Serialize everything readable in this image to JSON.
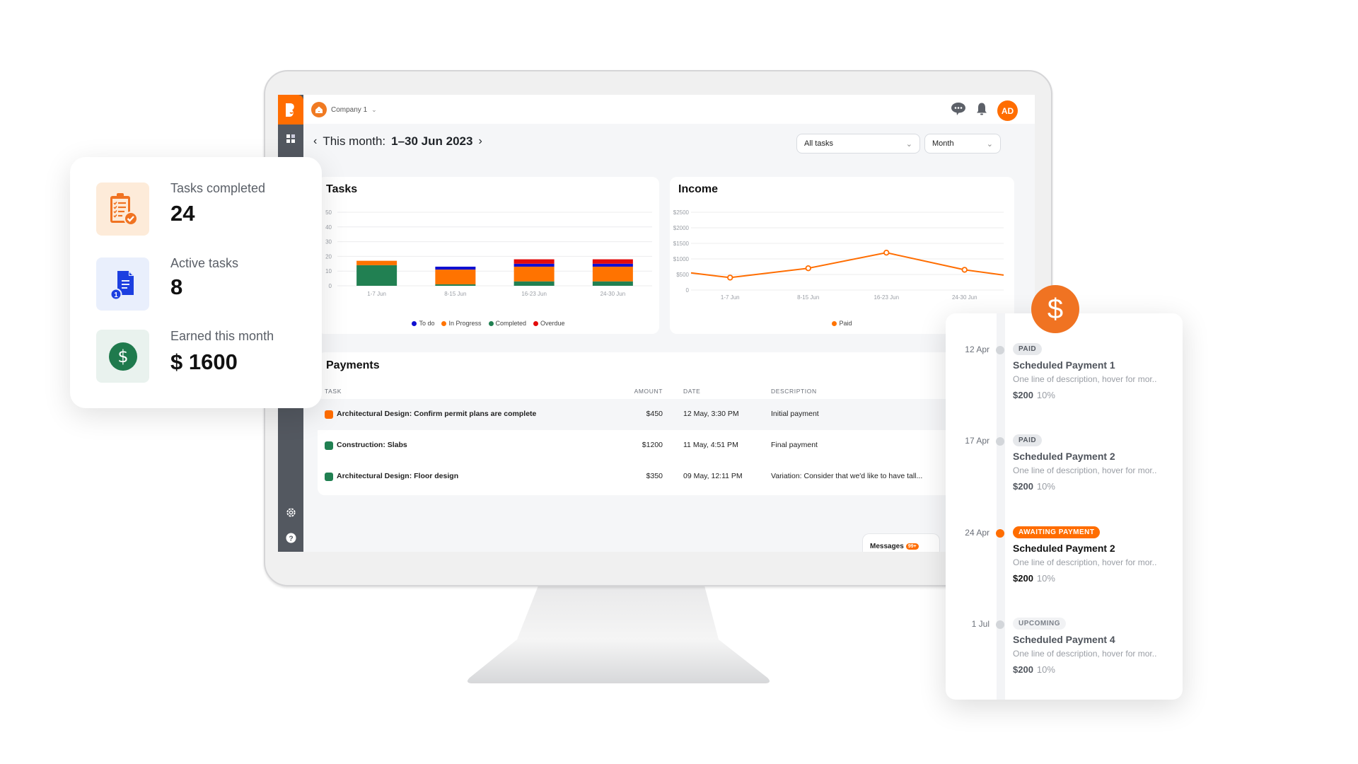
{
  "app": {
    "company": "Company 1",
    "period_prefix": "This month:",
    "period_value": "1–30 Jun 2023",
    "avatar_initials": "AD",
    "filters": {
      "tasks_filter": "All tasks",
      "range_filter": "Month"
    },
    "messages": {
      "label": "Messages",
      "badge": "99+"
    }
  },
  "colors": {
    "brand": "#ff6d00",
    "todo": "#1010d0",
    "in_progress": "#ff7300",
    "completed": "#218052",
    "overdue": "#e30b0b",
    "sidebar": "#535860"
  },
  "stats": [
    {
      "label": "Tasks completed",
      "value": "24",
      "icon": "clipboard-check-icon"
    },
    {
      "label": "Active tasks",
      "value": "8",
      "icon": "document-badge-icon"
    },
    {
      "label": "Earned this month",
      "value": "$ 1600",
      "icon": "dollar-icon"
    }
  ],
  "chart_data": [
    {
      "type": "bar",
      "stacked": true,
      "title": "Tasks",
      "categories": [
        "1-7 Jun",
        "8-15 Jun",
        "16-23 Jun",
        "24-30 Jun"
      ],
      "series": [
        {
          "name": "Completed",
          "values": [
            14,
            1,
            3,
            3
          ]
        },
        {
          "name": "In Progress",
          "values": [
            3,
            10,
            10,
            10
          ]
        },
        {
          "name": "To do",
          "values": [
            0,
            2,
            2,
            2
          ]
        },
        {
          "name": "Overdue",
          "values": [
            0,
            0,
            3,
            3
          ]
        }
      ],
      "legend": [
        "To do",
        "In Progress",
        "Completed",
        "Overdue"
      ],
      "yticks": [
        "0",
        "10",
        "20",
        "30",
        "40",
        "50"
      ],
      "ylim": [
        0,
        50
      ],
      "legend_position": "bottom",
      "grid": true
    },
    {
      "type": "line",
      "title": "Income",
      "categories": [
        "1-7 Jun",
        "8-15 Jun",
        "16-23 Jun",
        "24-30 Jun"
      ],
      "series": [
        {
          "name": "Paid",
          "values": [
            400,
            700,
            1200,
            650
          ],
          "start_value": 550,
          "end_value": 480
        }
      ],
      "yticks": [
        "0",
        "$500",
        "$1000",
        "$1500",
        "$2000",
        "$2500"
      ],
      "ylim": [
        0,
        2500
      ],
      "legend_position": "bottom",
      "grid": true
    }
  ],
  "payments": {
    "title": "Payments",
    "columns": [
      "TASK",
      "AMOUNT",
      "DATE",
      "DESCRIPTION"
    ],
    "rows": [
      {
        "task": "Architectural Design: Confirm permit plans are complete",
        "amount": "$450",
        "date": "12 May, 3:30 PM",
        "description": "Initial payment",
        "color": "#ff6d00"
      },
      {
        "task": "Construction: Slabs",
        "amount": "$1200",
        "date": "11 May, 4:51 PM",
        "description": "Final payment",
        "color": "#218052"
      },
      {
        "task": "Architectural Design: Floor design",
        "amount": "$350",
        "date": "09 May, 12:11 PM",
        "description": "Variation: Consider that we'd like to have tall...",
        "color": "#218052"
      }
    ]
  },
  "timeline": {
    "items": [
      {
        "date": "12 Apr",
        "status": "PAID",
        "title": "Scheduled Payment 1",
        "description": "One line of description, hover for mor..",
        "amount": "$200",
        "percent": "10%"
      },
      {
        "date": "17 Apr",
        "status": "PAID",
        "title": "Scheduled Payment 2",
        "description": "One line of description, hover for mor..",
        "amount": "$200",
        "percent": "10%"
      },
      {
        "date": "24 Apr",
        "status": "AWAITING PAYMENT",
        "title": "Scheduled Payment 2",
        "description": "One line of description, hover for mor..",
        "amount": "$200",
        "percent": "10%"
      },
      {
        "date": "1 Jul",
        "status": "UPCOMING",
        "title": "Scheduled Payment 4",
        "description": "One line of description, hover for mor..",
        "amount": "$200",
        "percent": "10%"
      }
    ]
  }
}
